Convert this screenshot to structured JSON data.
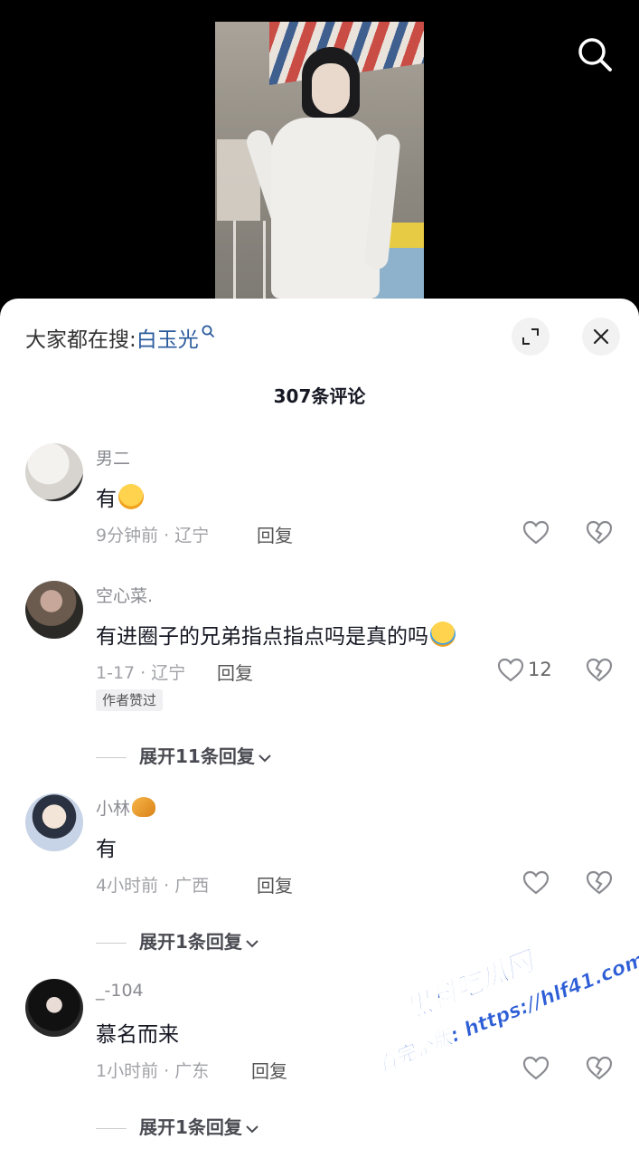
{
  "header": {
    "hot_search_prefix": "大家都在搜:",
    "hot_search_term": "白玉光"
  },
  "comments_count_label": "307条评论",
  "comments": [
    {
      "username": "男二",
      "text": "有",
      "emoji": "drooling-face-emoji",
      "meta": "9分钟前 · 辽宁",
      "reply_label": "回复",
      "likes": ""
    },
    {
      "username": "空心菜.",
      "text": "有进圈子的兄弟指点指点吗是真的吗",
      "emoji": "crying-face-emoji",
      "meta": "1-17 · 辽宁",
      "reply_label": "回复",
      "likes": "12",
      "badge": "作者赞过",
      "expand_label": "展开11条回复"
    },
    {
      "username": "小林",
      "username_emoji": "croissant-emoji",
      "text": "有",
      "meta": "4小时前 · 广西",
      "reply_label": "回复",
      "likes": "",
      "expand_label": "展开1条回复"
    },
    {
      "username": "_-104",
      "text": "慕名而来",
      "meta": "1小时前 · 广东",
      "reply_label": "回复",
      "likes": "",
      "expand_label": "展开1条回复"
    }
  ],
  "watermark": {
    "line1": "黑料吃瓜网",
    "line2": "看完整版: https://hlf41.com"
  },
  "icons": {
    "search": "search-icon",
    "expand": "fullscreen-icon",
    "close": "close-icon",
    "like": "heart-icon",
    "dislike": "broken-heart-icon"
  }
}
